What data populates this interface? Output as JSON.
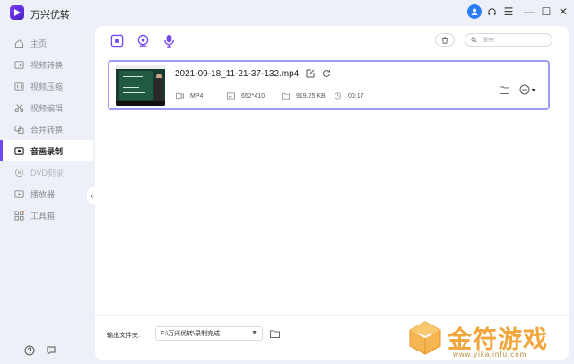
{
  "app": {
    "title": "万兴优转"
  },
  "colors": {
    "accent": "#7347f2",
    "card_border": "#9d9ef2",
    "avatar": "#2c7cf6",
    "watermark": "#f2a53a"
  },
  "titlebar": {
    "icons": [
      "user-avatar-icon",
      "headset-icon",
      "menu-icon",
      "minimize-icon",
      "maximize-icon",
      "close-icon"
    ],
    "minimize": "—",
    "maximize": "☐",
    "close": "✕",
    "menu": "☰"
  },
  "sidebar": {
    "items": [
      {
        "label": "主页",
        "icon": "home-icon",
        "active": false
      },
      {
        "label": "视频转换",
        "icon": "convert-icon",
        "active": false
      },
      {
        "label": "视频压缩",
        "icon": "compress-icon",
        "active": false
      },
      {
        "label": "视频编辑",
        "icon": "scissors-icon",
        "active": false
      },
      {
        "label": "合并转换",
        "icon": "merge-icon",
        "active": false
      },
      {
        "label": "音画录制",
        "icon": "record-icon",
        "active": true
      },
      {
        "label": "DVD刻录",
        "icon": "disc-icon",
        "active": false
      },
      {
        "label": "播放器",
        "icon": "player-icon",
        "active": false
      },
      {
        "label": "工具箱",
        "icon": "toolbox-icon",
        "active": false
      }
    ],
    "collapse_glyph": "‹"
  },
  "toolbar": {
    "mode_tabs": [
      "screen-record-icon",
      "webcam-record-icon",
      "audio-record-icon"
    ],
    "search_placeholder": "搜索"
  },
  "file": {
    "name": "2021-09-18_11-21-37-132.mp4",
    "format": "MP4",
    "resolution": "652*410",
    "size": "919.25 KB",
    "duration": "00:17"
  },
  "footer": {
    "output_label": "输出文件夹:",
    "output_path": "F:\\万兴优转\\录制完成"
  },
  "watermark": {
    "text": "金符游戏",
    "url": "www.yikajinfu.com"
  }
}
